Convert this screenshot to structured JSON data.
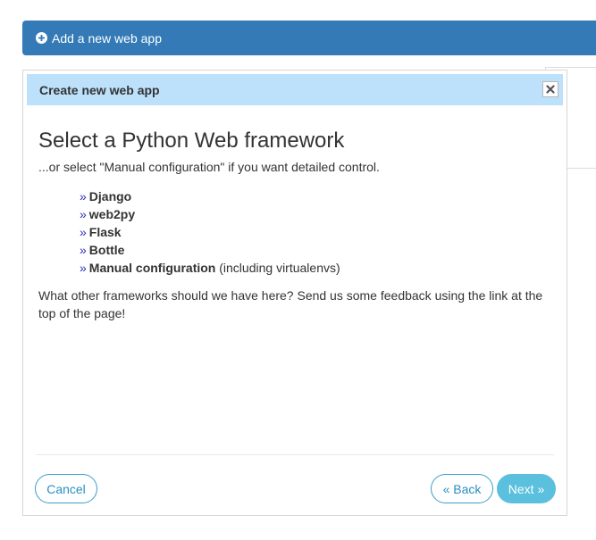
{
  "top_bar": {
    "label": "Add a new web app",
    "icon": "plus-circle-icon"
  },
  "dialog": {
    "title": "Create new web app",
    "close_icon": "close-icon",
    "heading": "Select a Python Web framework",
    "subtitle": "...or select \"Manual configuration\" if you want detailed control.",
    "bullet": "»",
    "frameworks": [
      {
        "label": "Django",
        "note": ""
      },
      {
        "label": "web2py",
        "note": ""
      },
      {
        "label": "Flask",
        "note": ""
      },
      {
        "label": "Bottle",
        "note": ""
      },
      {
        "label": "Manual configuration",
        "note": "(including virtualenvs)"
      }
    ],
    "feedback": "What other frameworks should we have here? Send us some feedback using the link at the top of the page!",
    "buttons": {
      "cancel": "Cancel",
      "back": "« Back",
      "next": "Next »"
    }
  },
  "colors": {
    "primary": "#337ab7",
    "header_bg": "#bde0fb",
    "info": "#5bc0de",
    "link_bullet": "#2a2ab5"
  }
}
